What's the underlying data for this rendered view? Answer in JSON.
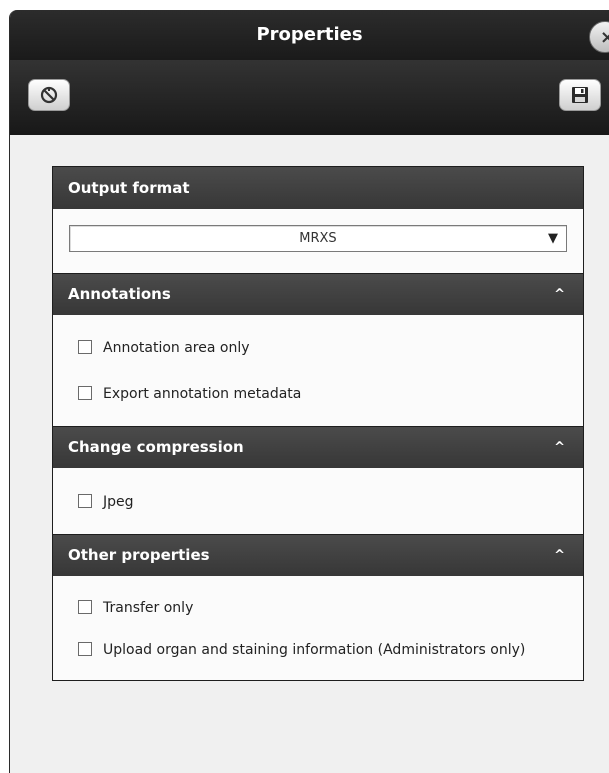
{
  "window": {
    "title": "Properties",
    "close_glyph": "×"
  },
  "toolbar": {
    "reset_icon": "reset-icon",
    "save_icon": "save-icon"
  },
  "output_format": {
    "header": "Output format",
    "selected": "MRXS",
    "arrow": "▼"
  },
  "annotations": {
    "header": "Annotations",
    "chevron": "^",
    "options": [
      {
        "label": "Annotation area only",
        "checked": false
      },
      {
        "label": "Export annotation metadata",
        "checked": false
      }
    ]
  },
  "compression": {
    "header": "Change compression",
    "chevron": "^",
    "options": [
      {
        "label": "Jpeg",
        "checked": false
      }
    ]
  },
  "other": {
    "header": "Other properties",
    "chevron": "^",
    "options": [
      {
        "label": "Transfer only",
        "checked": false
      },
      {
        "label": "Upload organ and staining information (Administrators only)",
        "checked": false
      }
    ]
  },
  "colors": {
    "titlebar": "#1f1f1f",
    "section_header": "#424242",
    "panel_background": "#fbfbfb"
  }
}
